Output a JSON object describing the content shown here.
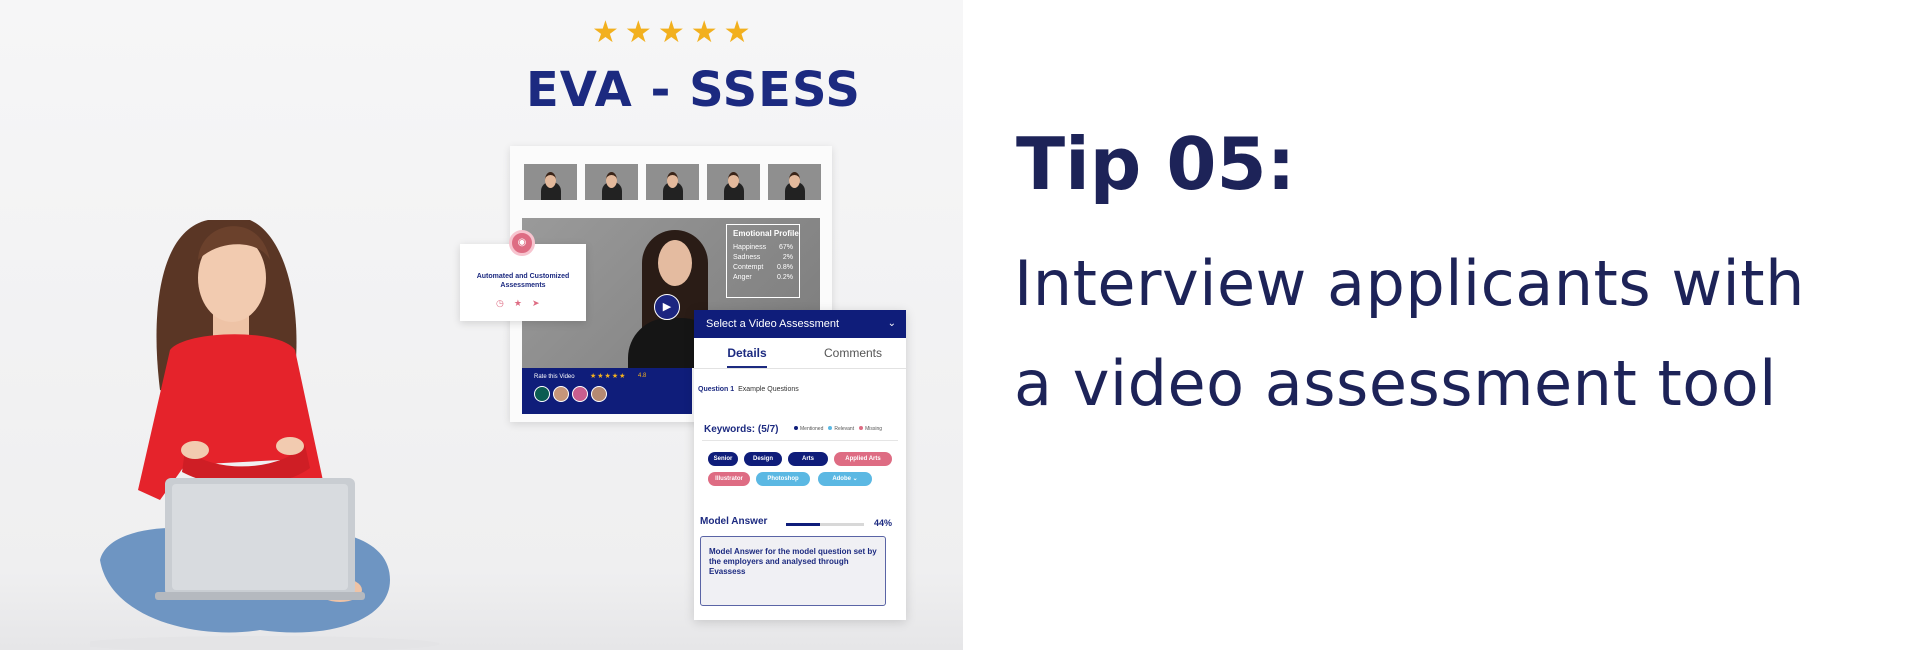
{
  "header": {
    "rating_stars": 5,
    "logo_text": "EVA - SSESS"
  },
  "app_card": {
    "emotional_profile": {
      "title": "Emotional Profile",
      "rows": [
        {
          "label": "Happiness",
          "value": "67%"
        },
        {
          "label": "Sadness",
          "value": "2%"
        },
        {
          "label": "Contempt",
          "value": "0.8%"
        },
        {
          "label": "Anger",
          "value": "0.2%"
        }
      ]
    },
    "rate_label": "Rate this Video",
    "rate_stars": "★★★★★",
    "rate_score": "4.8"
  },
  "tag_card": {
    "text": "Automated and Customized Assessments"
  },
  "assessment": {
    "select_label": "Select a Video Assessment",
    "tabs": [
      "Details",
      "Comments"
    ],
    "question_label": "Question 1",
    "question_text": "Example Questions",
    "keywords_title": "Keywords: (5/7)",
    "legend": [
      "Mentioned",
      "Relevant",
      "Missing"
    ],
    "chips": [
      "Senior",
      "Design",
      "Arts",
      "Applied Arts",
      "Illustrator",
      "Photoshop",
      "Adobe"
    ],
    "model_answer_title": "Model Answer",
    "model_answer_percent": "44%",
    "model_answer_progress": 0.44,
    "model_answer_text": "Model Answer for the model question set by the employers and analysed through Evassess"
  },
  "tip": {
    "title": "Tip 05:",
    "line1": "Interview applicants with",
    "line2": "a video assessment tool"
  },
  "colors": {
    "navy": "#1c2a80",
    "star": "#f2b01e",
    "pink": "#de6c83",
    "light_blue": "#5bb8e3"
  }
}
